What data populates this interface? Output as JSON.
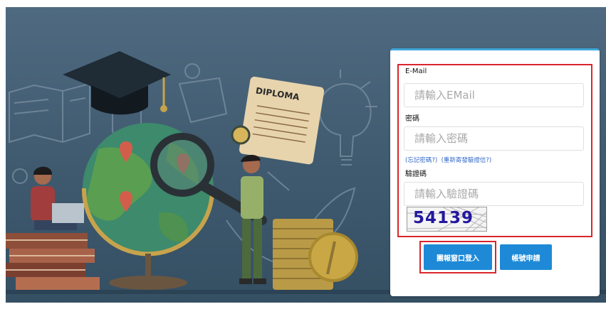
{
  "form": {
    "email": {
      "label": "E-Mail",
      "placeholder": "請輸入EMail"
    },
    "password": {
      "label": "密碼",
      "placeholder": "請輸入密碼"
    },
    "forgot_link": "(忘記密碼?)",
    "resend_link": "(重新寄發驗證信?)",
    "captcha": {
      "label": "驗證碼",
      "placeholder": "請輸入驗證碼",
      "image_text": "54139"
    }
  },
  "buttons": {
    "login_label": "團報窗口登入",
    "register_label": "帳號申請"
  },
  "illustration": {
    "diploma_text": "DIPLOMA"
  },
  "colors": {
    "background": "#45607a",
    "panel_accent": "#3fa7d9",
    "button": "#1e8ad7",
    "highlight_box": "#d9262c",
    "link": "#3268c9",
    "captcha_text": "#24179e"
  },
  "icons": [
    "graduation-cap-icon",
    "diploma-icon",
    "globe-icon",
    "magnifier-icon",
    "lightbulb-icon",
    "book-icon",
    "coin-icon",
    "location-pin-icon"
  ]
}
